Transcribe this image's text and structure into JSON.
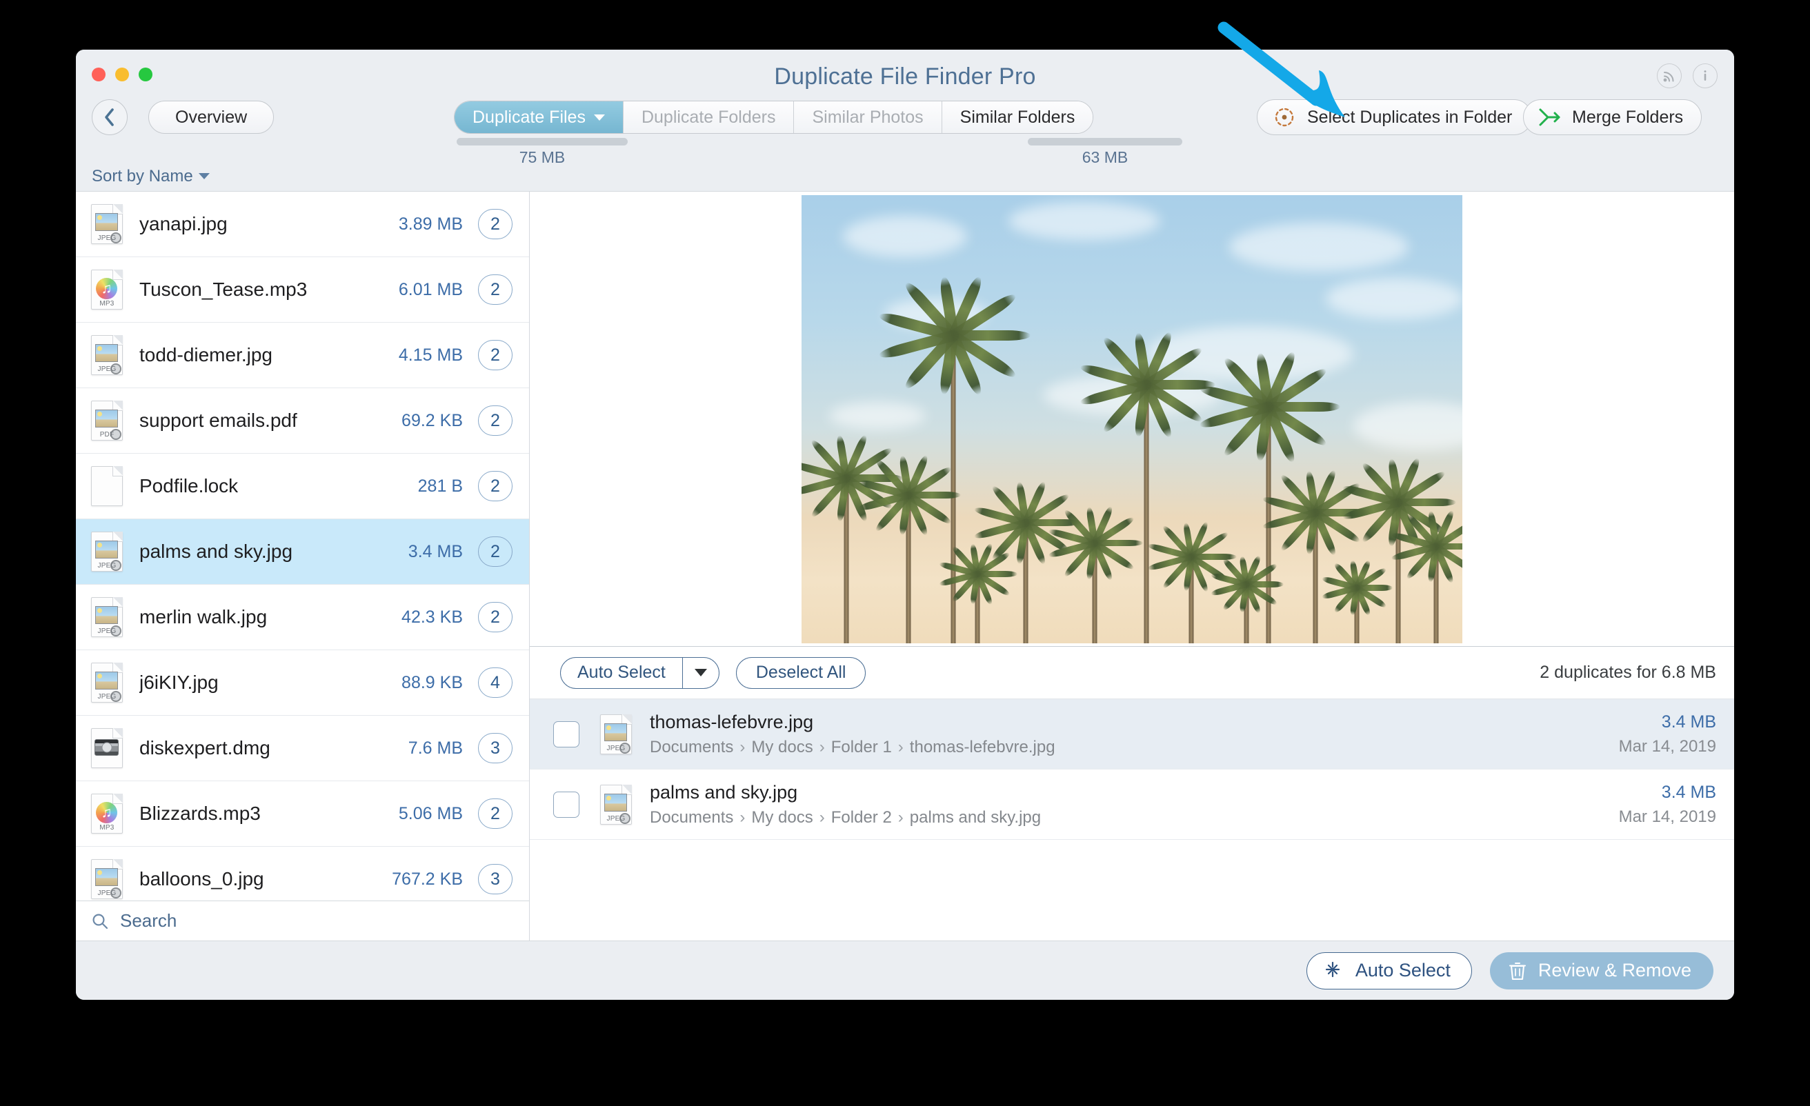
{
  "window": {
    "title": "Duplicate File Finder Pro",
    "traffic_lights": [
      "close",
      "minimize",
      "zoom"
    ],
    "titlebar_icons": [
      "rss-icon",
      "info-icon"
    ]
  },
  "colors": {
    "accent_blue": "#4e7094",
    "active_tab": "#80bdd8",
    "selected_row": "#c9e9fa",
    "link_blue": "#3d6da8",
    "arrow_annotation": "#14a8e8",
    "review_remove_bg": "#97bdd8",
    "merge_icon_green": "#22b14c",
    "select_dupes_icon_orange": "#c4793c"
  },
  "toolbar": {
    "back_label": "back",
    "overview_label": "Overview",
    "tabs": [
      {
        "label": "Duplicate Files",
        "state": "active",
        "has_caret": true
      },
      {
        "label": "Duplicate Folders",
        "state": "disabled",
        "has_caret": false
      },
      {
        "label": "Similar Photos",
        "state": "disabled",
        "has_caret": false
      },
      {
        "label": "Similar Folders",
        "state": "enabled",
        "has_caret": false
      }
    ],
    "select_duplicates_label": "Select Duplicates in Folder",
    "merge_folders_label": "Merge Folders",
    "size_indicators": [
      {
        "label": "75 MB"
      },
      {
        "label": "63 MB"
      }
    ]
  },
  "sidebar": {
    "sort_label": "Sort by Name",
    "search_placeholder": "Search",
    "files": [
      {
        "name": "yanapi.jpg",
        "size": "3.89 MB",
        "count": "2",
        "icon": "jpeg-file-icon",
        "ext": "JPEG",
        "selected": false
      },
      {
        "name": "Tuscon_Tease.mp3",
        "size": "6.01 MB",
        "count": "2",
        "icon": "mp3-file-icon",
        "ext": "MP3",
        "selected": false
      },
      {
        "name": "todd-diemer.jpg",
        "size": "4.15 MB",
        "count": "2",
        "icon": "jpeg-file-icon",
        "ext": "JPEG",
        "selected": false
      },
      {
        "name": "support emails.pdf",
        "size": "69.2 KB",
        "count": "2",
        "icon": "pdf-file-icon",
        "ext": "PDF",
        "selected": false
      },
      {
        "name": "Podfile.lock",
        "size": "281 B",
        "count": "2",
        "icon": "blank-file-icon",
        "ext": "",
        "selected": false
      },
      {
        "name": "palms and sky.jpg",
        "size": "3.4 MB",
        "count": "2",
        "icon": "jpeg-file-icon",
        "ext": "JPEG",
        "selected": true
      },
      {
        "name": "merlin walk.jpg",
        "size": "42.3 KB",
        "count": "2",
        "icon": "jpeg-file-icon",
        "ext": "JPEG",
        "selected": false
      },
      {
        "name": "j6iKIY.jpg",
        "size": "88.9 KB",
        "count": "4",
        "icon": "jpeg-file-icon",
        "ext": "JPEG",
        "selected": false
      },
      {
        "name": "diskexpert.dmg",
        "size": "7.6 MB",
        "count": "3",
        "icon": "dmg-file-icon",
        "ext": "",
        "selected": false
      },
      {
        "name": "Blizzards.mp3",
        "size": "5.06 MB",
        "count": "2",
        "icon": "mp3-file-icon",
        "ext": "MP3",
        "selected": false
      },
      {
        "name": "balloons_0.jpg",
        "size": "767.2 KB",
        "count": "3",
        "icon": "jpeg-file-icon",
        "ext": "JPEG",
        "selected": false
      }
    ]
  },
  "preview": {
    "image_description": "palms and sky.jpg photo preview"
  },
  "duplicates_panel": {
    "auto_select_label": "Auto Select",
    "deselect_all_label": "Deselect All",
    "summary": "2 duplicates for 6.8 MB",
    "rows": [
      {
        "name": "thomas-lefebvre.jpg",
        "path": [
          "Documents",
          "My docs",
          "Folder 1",
          "thomas-lefebvre.jpg"
        ],
        "size": "3.4 MB",
        "date": "Mar 14, 2019",
        "checked": false,
        "icon": "jpeg-file-icon",
        "ext": "JPEG"
      },
      {
        "name": "palms and sky.jpg",
        "path": [
          "Documents",
          "My docs",
          "Folder 2",
          "palms and sky.jpg"
        ],
        "size": "3.4 MB",
        "date": "Mar 14, 2019",
        "checked": false,
        "icon": "jpeg-file-icon",
        "ext": "JPEG"
      }
    ]
  },
  "footer": {
    "auto_select_label": "Auto Select",
    "review_remove_label": "Review & Remove"
  },
  "annotation": {
    "type": "arrow",
    "points_to": "Select Duplicates in Folder"
  }
}
